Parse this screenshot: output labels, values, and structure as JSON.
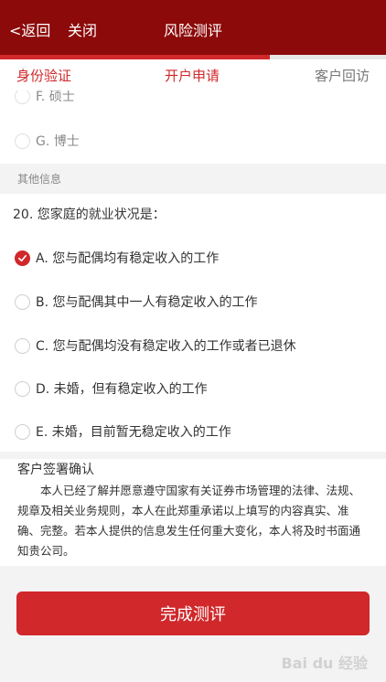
{
  "header": {
    "back_label": "<返回",
    "close_label": "关闭",
    "title": "风险测评",
    "progress_percent": 70
  },
  "steps": [
    {
      "label": "身份验证",
      "state": "done"
    },
    {
      "label": "开户申请",
      "state": "active"
    },
    {
      "label": "客户回访",
      "state": "todo"
    }
  ],
  "prev_options": [
    {
      "label": "F. 硕士",
      "checked": false
    },
    {
      "label": "G. 博士",
      "checked": false
    }
  ],
  "section_title": "其他信息",
  "question": {
    "text": "20. 您家庭的就业状况是：",
    "options": [
      {
        "label": "A. 您与配偶均有稳定收入的工作",
        "checked": true
      },
      {
        "label": "B. 您与配偶其中一人有稳定收入的工作",
        "checked": false
      },
      {
        "label": "C. 您与配偶均没有稳定收入的工作或者已退休",
        "checked": false
      },
      {
        "label": "D. 未婚，但有稳定收入的工作",
        "checked": false
      },
      {
        "label": "E. 未婚，目前暂无稳定收入的工作",
        "checked": false
      }
    ]
  },
  "signature": {
    "title": "客户签署确认",
    "text": "本人已经了解并愿意遵守国家有关证券市场管理的法律、法规、规章及相关业务规则，本人在此郑重承诺以上填写的内容真实、准确、完整。若本人提供的信息发生任何重大变化，本人将及时书面通知贵公司。"
  },
  "submit_label": "完成测评",
  "watermark": "Bai du 经验",
  "colors": {
    "header_bg": "#8c0a0a",
    "accent": "#d0282b"
  }
}
